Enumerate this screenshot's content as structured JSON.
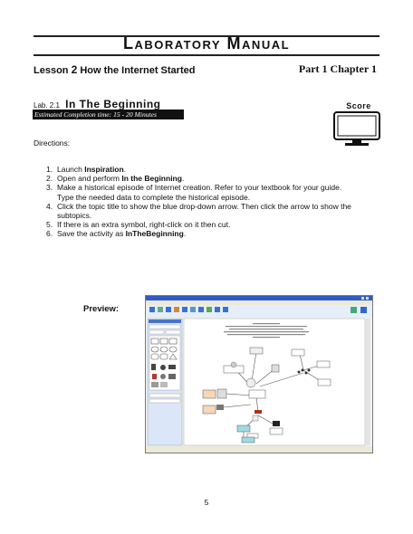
{
  "header": {
    "manual_title": "Laboratory Manual",
    "lesson_label": "Lesson",
    "lesson_number": "2",
    "lesson_title": "How the Internet Started",
    "part_label": "Part",
    "part_number": "1",
    "chapter_label": "Chapter",
    "chapter_number": "1"
  },
  "lab": {
    "number": "Lab. 2.1",
    "title": "In The Beginning",
    "estimated_time": "Estimated Completion time: 15 - 20 Minutes"
  },
  "score": {
    "label": "Score"
  },
  "directions": {
    "label": "Directions:",
    "steps": [
      {
        "num": "1.",
        "pre": "Launch ",
        "bold": "Inspiration",
        "post": "."
      },
      {
        "num": "2.",
        "pre": "Open and perform  ",
        "bold": "In the Beginning",
        "post": "."
      },
      {
        "num": "3.",
        "pre": "Make a historical episode of Internet creation. Refer to your textbook for your guide.",
        "bold": "",
        "post": "",
        "sub": "Type the needed data to complete the historical episode."
      },
      {
        "num": "4.",
        "pre": "Click the topic title to show the blue drop-down arrow. Then click the arrow to show the",
        "bold": "",
        "post": "",
        "sub": "subtopics."
      },
      {
        "num": "5.",
        "pre": "If there is an extra symbol, right-click on it then cut.",
        "bold": "",
        "post": ""
      },
      {
        "num": "6.",
        "pre": "Save the activity as ",
        "bold": "InTheBeginning",
        "post": "."
      }
    ]
  },
  "preview": {
    "label": "Preview:"
  },
  "page_number": "5",
  "colors": {
    "ink": "#111111",
    "time_bar": "#111111",
    "preview_bg": "#f3f3f3",
    "node_tan": "#f5d7b8",
    "node_blue": "#9fd9e6"
  }
}
